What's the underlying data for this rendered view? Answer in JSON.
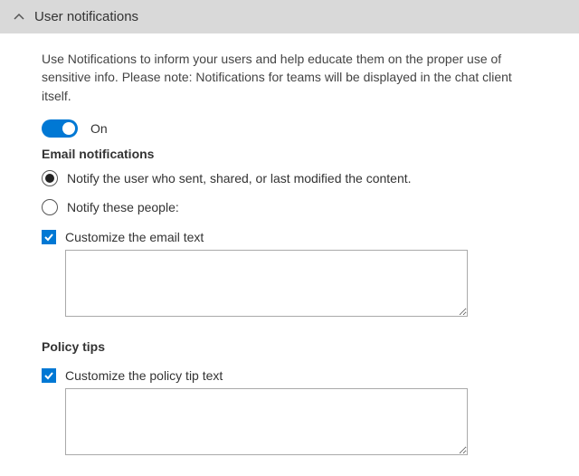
{
  "header": {
    "title": "User notifications"
  },
  "description": "Use Notifications to inform your users and help educate them on the proper use of sensitive info. Please note: Notifications for teams will be displayed in the chat client itself.",
  "toggle": {
    "state_label": "On",
    "on": true
  },
  "email": {
    "section_title": "Email notifications",
    "radio_options": [
      {
        "label": "Notify the user who sent, shared, or last modified the content.",
        "selected": true
      },
      {
        "label": "Notify these people:",
        "selected": false
      }
    ],
    "customize_label": "Customize the email text",
    "customize_checked": true,
    "customize_text": ""
  },
  "policy": {
    "section_title": "Policy tips",
    "customize_label": "Customize the policy tip text",
    "customize_checked": true,
    "customize_text": ""
  },
  "colors": {
    "accent": "#0078d4",
    "header_bg": "#d9d9d9"
  }
}
